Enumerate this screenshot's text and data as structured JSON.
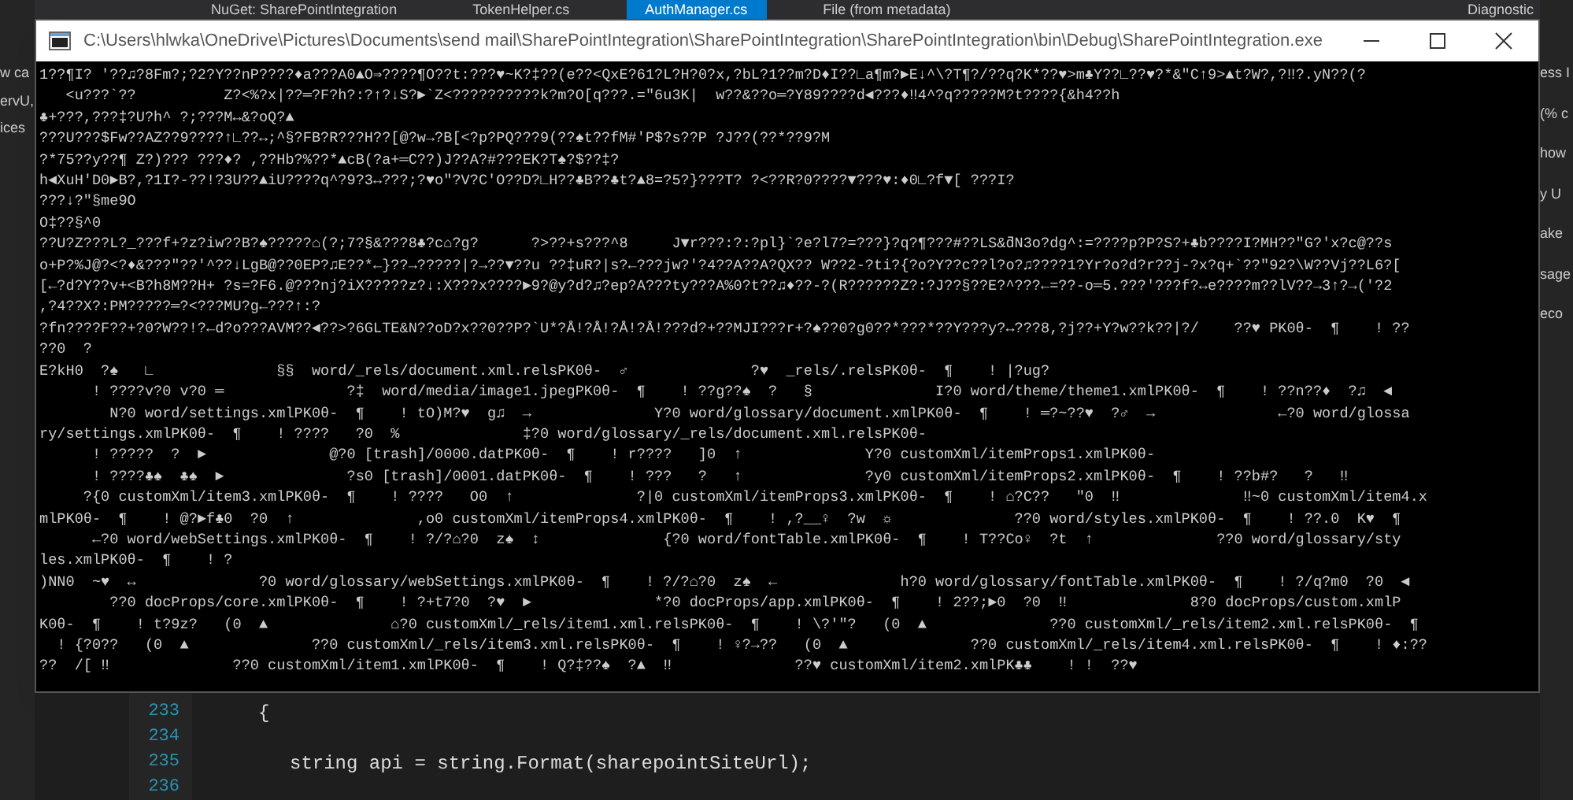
{
  "ide_tabs": [
    {
      "label": "NuGet: SharePointIntegration",
      "selected": false
    },
    {
      "label": "TokenHelper.cs",
      "selected": false
    },
    {
      "label": "AuthManager.cs",
      "selected": true
    },
    {
      "label": "File (from metadata)",
      "selected": false
    }
  ],
  "left_fragments": [
    "w ca",
    "ervU,",
    "ices"
  ],
  "top_right_label": "Diagnostic",
  "right_fragments": [
    "ess I",
    "(% c",
    "how",
    "y U",
    "ake",
    "sage",
    "eco"
  ],
  "console": {
    "title": "C:\\Users\\hlwka\\OneDrive\\Pictures\\Documents\\send mail\\SharePointIntegration\\SharePointIntegration\\SharePointIntegration\\bin\\Debug\\SharePointIntegration.exe",
    "lines": [
      "1??¶I? '??♫?8Fm?;?2?Y??nP????♦a???A0▲O⇒????¶O??t:???♥~K?‡??(e??<QxE?61?L?H?0?x,?bL?1??m?D♦I??∟a¶m?►E↓^\\?T¶?/??q?K*??♥>m♣Y??∟??♥?*&\"C↑9>▲t?W?,?‼?.yN??(?",
      "   <u???`??          Z?<%?x|??═?F?h?:?↑?↓S?►`Z<??????????k?m?O[q???.=\"6u3K|  w??&??o═?Y89????d◄???♦‼4^?q?????M?t????{&h4??h",
      "♣+???,???‡?U?h^ ?;???M↔&?oQ?▲",
      "???U???$Fw??AZ??9????↑∟??↔;^§?FB?R???H??[@?w→?B[<?p?PQ???9(??♠t??fM#'P$?s??P ?J??(??*??9?M",
      "?*75??y??¶ Z?)??? ???♦? ,??Hb?%??*▲cB(?a+═C??)J??A?#???EK?T♠?$??‡?",
      "h◄XuH'D0►B?,?1I?-??!?3U??▲iU????q^?9?3↔???;?♥o\"?V?C'O??D?∟H??♣B??♣t?▲8=?5?}???T? ?<??R?0????▼???♥:♦0∟?f▼[ ???I?",
      "???↓?\"§me9O",
      "O‡??§^0",
      "??U?Z???L?_???f+?z?iw??B?♠?????⌂(?;7?§&???8♣?c⌂?g?      ?>??+s???^8     J▼r???:?:?pl}`?e?l7?=???}?q?¶???#??LS&ƌN3o?dg^:=????p?P?S?+♣b????I?MH??\"G?'x?c@??s",
      "o+P?%J@?<?♦&???\"??'^??↓LgB@??0EP?♫E??*←}??→?????|?→??▼??u ??‡uR?|s?←???jw?'?4??A??A?QX?? W??2-?ti?{?o?Y??c??l?o?♫????1?Yr?o?d?r??j-?x?q+`??\"92?\\W??Vj??L6?[",
      "[←?d?Y??v+<B?h8M??H+ ?s=?F6.@???nj?iX?????z?↓:X???x????►9?@y?d?♫?ep?A???ty???A%0?t??♫♦??-?(R??????Z?:?J??§??E?^???←=??-o═5.???'???f?↔e????m??lV??→3↑?→('?2",
      ",?4??X?:PM?????═?<???MU?g←???↑:?",
      "?fn????F??+?0?W??!?←d?o???AVM??◄??>?6GLTE&N??oD?x??0??P?`U*?Å!?Å!?Å!?Å!???d?+??MJI???r+?♠??0?g0??*???*??Y???y?↔???8,?j??+Y?w??k??|?/    ??♥ PK0θ-  ¶    ! ??",
      "??0  ?",
      "E?kH0  ?♠   ∟              §§  word/_rels/document.xml.relsPK0θ-  ♂              ?♥  _rels/.relsPK0θ-  ¶    ! |?ug?",
      "      ! ????v?0 v?0 ═              ?‡  word/media/image1.jpegPK0θ-  ¶    ! ??g??♠  ?   §              I?0 word/theme/theme1.xmlPK0θ-  ¶    ! ??n??♦  ?♫  ◄",
      "        N?0 word/settings.xmlPK0θ-  ¶    ! tO)M?♥  g♫  →              Y?0 word/glossary/document.xmlPK0θ-  ¶    ! ═?~??♥  ?♂  →              ←?0 word/glossa",
      "ry/settings.xmlPK0θ-  ¶    ! ????   ?0  %              ‡?0 word/glossary/_rels/document.xml.relsPK0θ-",
      "      ! ?????  ?  ►              @?0 [trash]/0000.datPK0θ-  ¶    ! r????   ]0  ↑              Y?0 customXml/itemProps1.xmlPK0θ-",
      "      ! ????♣♠  ♣♠  ►              ?s0 [trash]/0001.datPK0θ-  ¶    ! ???   ?   ↑              ?y0 customXml/itemProps2.xmlPK0θ-  ¶    ! ??b#?   ?   ‼",
      "     ?{0 customXml/item3.xmlPK0θ-  ¶    ! ????   O0  ↑              ?|0 customXml/itemProps3.xmlPK0θ-  ¶    ! ⌂?C??   \"0  ‼              ‼~0 customXml/item4.x",
      "mlPK0θ-  ¶    ! @?►f♣0  ?0  ↑              ,o0 customXml/itemProps4.xmlPK0θ-  ¶    ! ,?__♀  ?w  ☼              ??0 word/styles.xmlPK0θ-  ¶    ! ??.0  K♥  ¶",
      "      ←?0 word/webSettings.xmlPK0θ-  ¶    ! ?/?⌂?0  z♠  ↕              {?0 word/fontTable.xmlPK0θ-  ¶    ! T??Co♀  ?t  ↑              ??0 word/glossary/sty",
      "les.xmlPK0θ-  ¶    ! ?",
      ")NN0  ~♥  ↔              ?0 word/glossary/webSettings.xmlPK0θ-  ¶    ! ?/?⌂?0  z♠  ←              h?0 word/glossary/fontTable.xmlPK0θ-  ¶    ! ?/q?m0  ?0  ◄",
      "        ??0 docProps/core.xmlPK0θ-  ¶    ! ?+t7?0  ?♥  ►              *?0 docProps/app.xmlPK0θ-  ¶    ! 2??;►0  ?0  ‼              8?0 docProps/custom.xmlP",
      "K0θ-  ¶    ! t?9z?   (0  ▲              ⌂?0 customXml/_rels/item1.xml.relsPK0θ-  ¶    ! \\?'\"?   (0  ▲              ??0 customXml/_rels/item2.xml.relsPK0θ-  ¶",
      "  ! {?0??   (0  ▲              ??0 customXml/_rels/item3.xml.relsPK0θ-  ¶    ! ♀?→??   (0  ▲              ??0 customXml/_rels/item4.xml.relsPK0θ-  ¶    ! ♦:??",
      "??  /[ ‼              ??0 customXml/item1.xmlPK0θ-  ¶    ! Q?‡??♠  ?▲  ‼              ??♥ customXml/item2.xmlPK♣♣    ! !  ??♥"
    ]
  },
  "editor": {
    "lines": [
      {
        "number": "233",
        "code": "{"
      },
      {
        "number": "234"
      },
      {
        "number": "235",
        "code": "string api = string.Format(sharepointSiteUrl);"
      },
      {
        "number": "236"
      }
    ]
  }
}
